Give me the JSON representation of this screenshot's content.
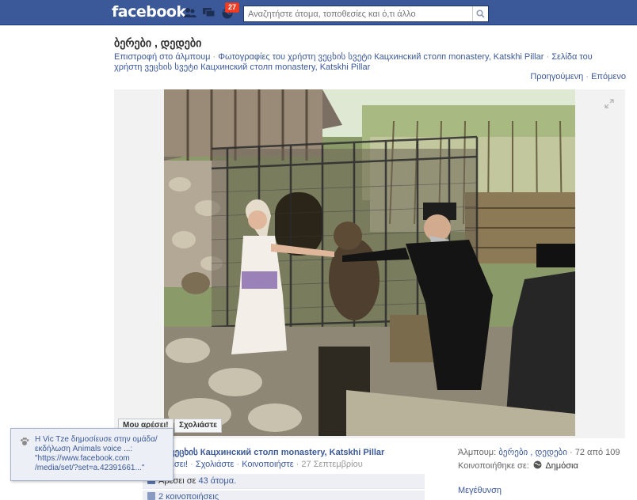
{
  "topbar": {
    "logo": "facebook",
    "notification_count": "27",
    "search_placeholder": "Αναζητήστε άτομα, τοποθεσίες και ό,τι άλλο"
  },
  "header": {
    "title": "ბერები , დედები",
    "crumbs": {
      "back": "Επιστροφή στο άλμπουμ",
      "photos_of": "Φωτογραφίες του χρήστη ვეცხის სვეტი Кацхинский столп monastery, Katskhi Pillar",
      "page_of": "Σελίδα του χρήστη ვეცხის სვეტი Кацхинский столп monastery, Katskhi Pillar"
    },
    "pager": {
      "prev": "Προηγούμενη",
      "next": "Επόμενο"
    }
  },
  "photo": {
    "like_button": "Μου αρέσει!",
    "comment_button": "Σχολιάστε"
  },
  "post": {
    "author": "ვეცხის Кацхинский столп monastery, Katskhi Pillar",
    "actions": {
      "like": "εσει!",
      "comment": "Σχολιάστε",
      "share": "Κοινοποιήστε",
      "date": "27 Σεπτεμβρίου"
    },
    "likes_prefix": "Αρέσει σε",
    "likes_count": "43 άτομα.",
    "shares": "2 κοινοποιήσεις"
  },
  "meta": {
    "album_label": "Άλμπουμ:",
    "album_name": "ბერები , დედები",
    "album_position": "· 72 από 109",
    "shared_label": "Κοινοποιήθηκε σε:",
    "shared_value": "Δημόσια",
    "enlarge": "Μεγέθυνση"
  },
  "notification": {
    "text": "Η Vic Tze δημοσίευσε στην ομάδα/εκδήλωση Animals voice ...: \"https://www.facebook.com /media/set/?set=a.42391661...\""
  },
  "colors": {
    "brand": "#3b5998",
    "badge": "#f03d25"
  }
}
